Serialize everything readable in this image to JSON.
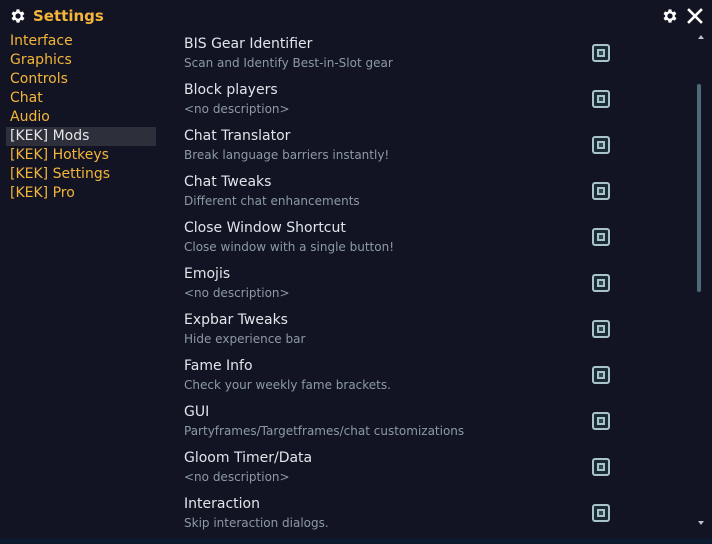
{
  "window": {
    "title": "Settings"
  },
  "sidebar": {
    "items": [
      {
        "label": "Interface"
      },
      {
        "label": "Graphics"
      },
      {
        "label": "Controls"
      },
      {
        "label": "Chat"
      },
      {
        "label": "Audio"
      },
      {
        "label": "[KEK] Mods",
        "active": true
      },
      {
        "label": "[KEK] Hotkeys"
      },
      {
        "label": "[KEK] Settings"
      },
      {
        "label": "[KEK] Pro"
      }
    ]
  },
  "mods": [
    {
      "name": "BIS Gear Identifier",
      "description": "Scan and Identify Best-in-Slot gear",
      "enabled": true
    },
    {
      "name": "Block players",
      "description": "<no description>",
      "enabled": true
    },
    {
      "name": "Chat Translator",
      "description": "Break language barriers instantly!",
      "enabled": true
    },
    {
      "name": "Chat Tweaks",
      "description": "Different chat enhancements",
      "enabled": true
    },
    {
      "name": "Close Window Shortcut",
      "description": "Close window with a single button!",
      "enabled": true
    },
    {
      "name": "Emojis",
      "description": "<no description>",
      "enabled": true
    },
    {
      "name": "Expbar Tweaks",
      "description": "Hide experience bar",
      "enabled": true
    },
    {
      "name": "Fame Info",
      "description": "Check your weekly fame brackets.",
      "enabled": true
    },
    {
      "name": "GUI",
      "description": "Partyframes/Targetframes/chat customizations",
      "enabled": true
    },
    {
      "name": "Gloom Timer/Data",
      "description": "<no description>",
      "enabled": true
    },
    {
      "name": "Interaction",
      "description": "Skip interaction dialogs.",
      "enabled": true
    }
  ],
  "colors": {
    "accent": "#f3b53a",
    "background": "#121423",
    "active_item_bg": "#2d2f3b",
    "checkbox": "#a9c3cd"
  },
  "icons": {
    "title": "gear-icon",
    "top_right": [
      "gear-icon",
      "close-icon"
    ]
  }
}
